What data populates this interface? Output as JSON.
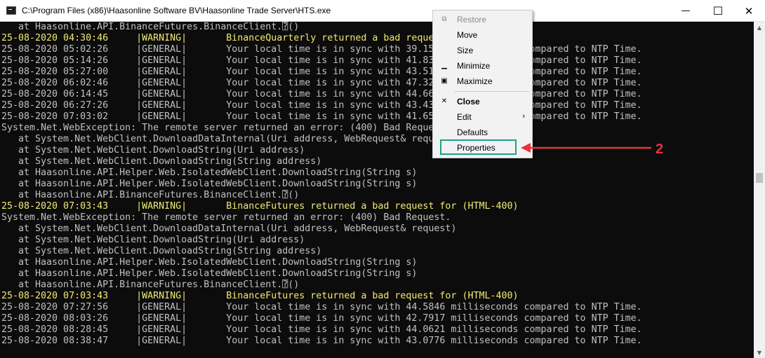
{
  "window": {
    "title": "C:\\Program Files (x86)\\Haasonline Software BV\\Haasonline Trade Server\\HTS.exe",
    "minimize_glyph": "—",
    "maximize_glyph": "☐",
    "close_glyph": "✕"
  },
  "console": {
    "lines": [
      {
        "text": "   at Haasonline.API.BinanceFutures.BinanceClient.⍰()",
        "color": "gray"
      },
      {
        "text": "25-08-2020 04:30:46     |WARNING|       BinanceQuarterly returned a bad request for (HTML-400)",
        "color": "yellow"
      },
      {
        "text": "25-08-2020 05:02:26     |GENERAL|       Your local time is in sync with 39.1535 milliseconds compared to NTP Time.",
        "color": "gray"
      },
      {
        "text": "25-08-2020 05:14:26     |GENERAL|       Your local time is in sync with 41.8312 milliseconds compared to NTP Time.",
        "color": "gray"
      },
      {
        "text": "25-08-2020 05:27:00     |GENERAL|       Your local time is in sync with 43.5101 milliseconds compared to NTP Time.",
        "color": "gray"
      },
      {
        "text": "25-08-2020 06:02:46     |GENERAL|       Your local time is in sync with 47.3268 milliseconds compared to NTP Time.",
        "color": "gray"
      },
      {
        "text": "25-08-2020 06:14:45     |GENERAL|       Your local time is in sync with 44.6690 milliseconds compared to NTP Time.",
        "color": "gray"
      },
      {
        "text": "25-08-2020 06:27:26     |GENERAL|       Your local time is in sync with 43.4388 milliseconds compared to NTP Time.",
        "color": "gray"
      },
      {
        "text": "25-08-2020 07:03:02     |GENERAL|       Your local time is in sync with 41.6532 milliseconds compared to NTP Time.",
        "color": "gray"
      },
      {
        "text": "System.Net.WebException: The remote server returned an error: (400) Bad Request.",
        "color": "gray"
      },
      {
        "text": "   at System.Net.WebClient.DownloadDataInternal(Uri address, WebRequest& request)",
        "color": "gray"
      },
      {
        "text": "   at System.Net.WebClient.DownloadString(Uri address)",
        "color": "gray"
      },
      {
        "text": "   at System.Net.WebClient.DownloadString(String address)",
        "color": "gray"
      },
      {
        "text": "   at Haasonline.API.Helper.Web.IsolatedWebClient.DownloadString(String s)",
        "color": "gray"
      },
      {
        "text": "   at Haasonline.API.Helper.Web.IsolatedWebClient.DownloadString(String s)",
        "color": "gray"
      },
      {
        "text": "   at Haasonline.API.BinanceFutures.BinanceClient.⍰()",
        "color": "gray"
      },
      {
        "text": "25-08-2020 07:03:43     |WARNING|       BinanceFutures returned a bad request for (HTML-400)",
        "color": "yellow"
      },
      {
        "text": "System.Net.WebException: The remote server returned an error: (400) Bad Request.",
        "color": "gray"
      },
      {
        "text": "   at System.Net.WebClient.DownloadDataInternal(Uri address, WebRequest& request)",
        "color": "gray"
      },
      {
        "text": "   at System.Net.WebClient.DownloadString(Uri address)",
        "color": "gray"
      },
      {
        "text": "   at System.Net.WebClient.DownloadString(String address)",
        "color": "gray"
      },
      {
        "text": "   at Haasonline.API.Helper.Web.IsolatedWebClient.DownloadString(String s)",
        "color": "gray"
      },
      {
        "text": "   at Haasonline.API.Helper.Web.IsolatedWebClient.DownloadString(String s)",
        "color": "gray"
      },
      {
        "text": "   at Haasonline.API.BinanceFutures.BinanceClient.⍰()",
        "color": "gray"
      },
      {
        "text": "25-08-2020 07:03:43     |WARNING|       BinanceFutures returned a bad request for (HTML-400)",
        "color": "yellow"
      },
      {
        "text": "25-08-2020 07:27:56     |GENERAL|       Your local time is in sync with 44.5846 milliseconds compared to NTP Time.",
        "color": "gray"
      },
      {
        "text": "25-08-2020 08:03:26     |GENERAL|       Your local time is in sync with 42.7917 milliseconds compared to NTP Time.",
        "color": "gray"
      },
      {
        "text": "25-08-2020 08:28:45     |GENERAL|       Your local time is in sync with 44.0621 milliseconds compared to NTP Time.",
        "color": "gray"
      },
      {
        "text": "25-08-2020 08:38:47     |GENERAL|       Your local time is in sync with 43.0776 milliseconds compared to NTP Time.",
        "color": "gray"
      }
    ]
  },
  "context_menu": {
    "items": [
      {
        "name": "restore",
        "label": "Restore",
        "icon": "restore-icon",
        "glyph": "⧉",
        "disabled": true
      },
      {
        "name": "move",
        "label": "Move",
        "icon": "",
        "glyph": "",
        "disabled": false
      },
      {
        "name": "size",
        "label": "Size",
        "icon": "",
        "glyph": "",
        "disabled": false
      },
      {
        "name": "minimize",
        "label": "Minimize",
        "icon": "minimize-icon",
        "glyph": "▁",
        "disabled": false
      },
      {
        "name": "maximize",
        "label": "Maximize",
        "icon": "maximize-icon",
        "glyph": "▣",
        "disabled": false
      },
      {
        "name": "close",
        "label": "Close",
        "icon": "close-icon",
        "glyph": "✕",
        "disabled": false,
        "bold": true
      },
      {
        "name": "edit",
        "label": "Edit",
        "icon": "",
        "glyph": "",
        "disabled": false,
        "submenu": true
      },
      {
        "name": "defaults",
        "label": "Defaults",
        "icon": "",
        "glyph": "",
        "disabled": false
      },
      {
        "name": "properties",
        "label": "Properties",
        "icon": "",
        "glyph": "",
        "disabled": false
      }
    ],
    "submenu_arrow": "›"
  },
  "annotation": {
    "number": "2",
    "color": "#e8333a",
    "highlight_color": "#1aa385"
  },
  "colors": {
    "console_bg": "#0c0c0c",
    "text_gray": "#c0c0c0",
    "text_yellow": "#f1ea73"
  }
}
